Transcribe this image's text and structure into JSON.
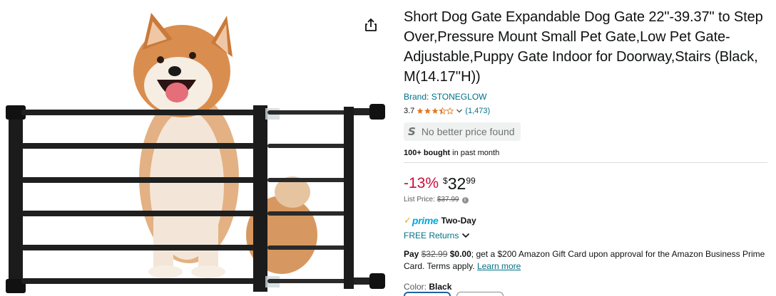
{
  "product": {
    "title": "Short Dog Gate Expandable Dog Gate 22\"-39.37\" to Step Over,Pressure Mount Small Pet Gate,Low Pet Gate-Adjustable,Puppy Gate Indoor for Doorway,Stairs (Black, M(14.17''H))",
    "brand": "Brand: STONEGLOW",
    "rating": "3.7",
    "rating_value": 3.7,
    "rating_count": "(1,473)",
    "price_chip": "No better price found",
    "bought_bold": "100+ bought",
    "bought_rest": " in past month",
    "discount": "-13%",
    "price_currency": "$",
    "price_whole": "32",
    "price_fraction": "99",
    "list_price_label": "List Price:",
    "list_price_value": "$37.99",
    "prime_word": "prime",
    "prime_delivery": "Two-Day",
    "returns": "FREE Returns",
    "pay_label": "Pay",
    "pay_old": "$32.99",
    "pay_new": "$0.00",
    "pay_text": "; get a $200 Amazon Gift Card upon approval for the Amazon Business Prime Card. Terms apply.",
    "pay_link": "Learn more",
    "color_label": "Color:",
    "color_value": "Black"
  },
  "icons": {
    "share": "share-icon",
    "chip": "s-logo-icon",
    "chevron": "chevron-down-icon",
    "info": "info-icon"
  },
  "colors": {
    "link": "#007185",
    "deal": "#cc0c39",
    "prime": "#00a8e1",
    "star": "#de7921",
    "swatch_selected": "#2162a1"
  }
}
